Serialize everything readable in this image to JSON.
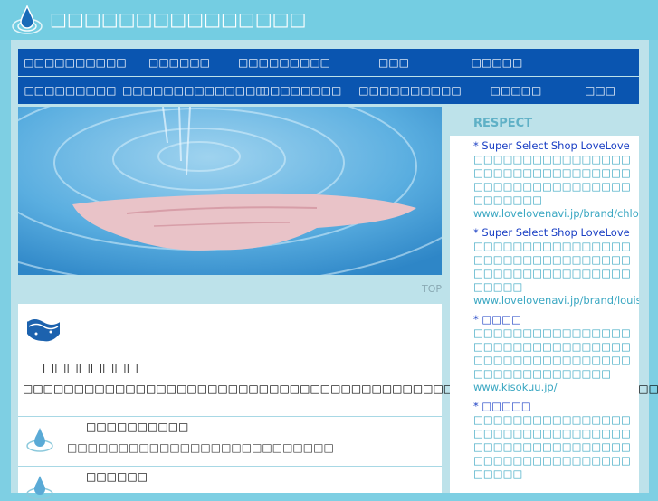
{
  "header": {
    "site_title": "□□□□□□□□□□□□□□□"
  },
  "nav": {
    "row1": [
      "□□□□□□□□□□",
      "□□□□□□",
      "□□□□□□□□□",
      "□□□",
      "□□□□□"
    ],
    "row2": [
      "□□□□□□□□□",
      "□□□□□□□□□□□□□□",
      "□□□□□□□□",
      "□□□□□□□□□□",
      "□□□□□",
      "□□□"
    ]
  },
  "hero": {
    "top_link": "TOP"
  },
  "main": {
    "title": "□□□□□□□□",
    "text": "□□□□□□□□□□□□□□□□□□□□□□□□□□□□□□□□□□□□□□□□□□□□□□□□□□□□□□□□□□□□□□□",
    "rows": [
      {
        "title": "□□□□□□□□□□",
        "desc": "□□□□□□□□□□□□□□□□□□□□□□□□□□"
      },
      {
        "title": "□□□□□□",
        "desc": ""
      }
    ]
  },
  "sidebar": {
    "heading": "RESPECT",
    "links": [
      {
        "title": "* Super Select Shop LoveLove",
        "desc": "□□□□□□□□□□□□□□□□□□□□□□□□□□□□□□□□□□□□□□□□□□□□□□□□□□□□□□□",
        "url": "www.lovelovenavi.jp/brand/chloe/"
      },
      {
        "title": "* Super Select Shop LoveLove",
        "desc": "□□□□□□□□□□□□□□□□□□□□□□□□□□□□□□□□□□□□□□□□□□□□□□□□□□□□□",
        "url": "www.lovelovenavi.jp/brand/louisvuitton/"
      },
      {
        "title": "* □□□□",
        "desc": "□□□□□□□□□□□□□□□□□□□□□□□□□□□□□□□□□□□□□□□□□□□□□□□□□□□□□□□□□□□□□□",
        "url": "www.kisokuu.jp/"
      },
      {
        "title": "* □□□□□",
        "desc": "□□□□□□□□□□□□□□□□□□□□□□□□□□□□□□□□□□□□□□□□□□□□□□□□□□□□□□□□□□□□□□□□□□□□□",
        "url": ""
      }
    ]
  },
  "colors": {
    "accent": "#0a55b0",
    "background": "#7ecfe3",
    "panel": "#bde2ea",
    "link": "#1a3fc4",
    "link_text": "#3aa7c2"
  },
  "icons": {
    "logo": "water-drop-icon",
    "main": "waves-icon",
    "rows": "water-drop-icon"
  }
}
